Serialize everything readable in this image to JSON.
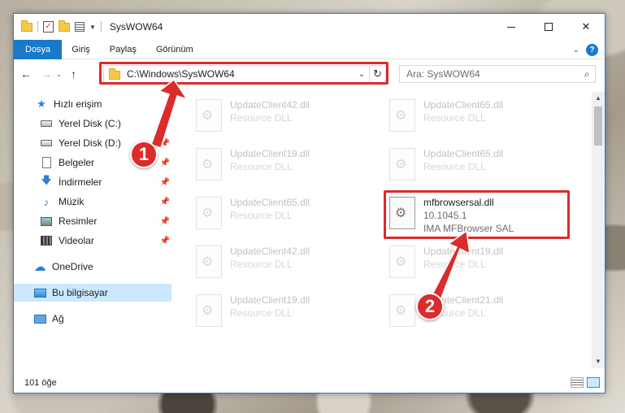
{
  "window": {
    "title": "SysWOW64",
    "controls": {
      "minimize": "",
      "maximize": "",
      "close": "✕"
    }
  },
  "ribbon": {
    "tabs": [
      {
        "label": "Dosya",
        "active": true
      },
      {
        "label": "Giriş"
      },
      {
        "label": "Paylaş"
      },
      {
        "label": "Görünüm"
      }
    ],
    "help": "?"
  },
  "nav": {
    "back": "←",
    "forward": "→",
    "recent": "⌄",
    "up": "↑",
    "address": "C:\\Windows\\SysWOW64",
    "refresh": "↻",
    "search_placeholder": "Ara: SysWOW64",
    "search_icon": "⌕"
  },
  "sidebar": {
    "items": [
      {
        "label": "Hızlı erişim",
        "icon": "star-icon",
        "glyph": "★",
        "pinned": false
      },
      {
        "label": "Yerel Disk (C:)",
        "icon": "drive-icon",
        "pinned": true
      },
      {
        "label": "Yerel Disk (D:)",
        "icon": "drive-icon",
        "pinned": true
      },
      {
        "label": "Belgeler",
        "icon": "document-icon",
        "pinned": true
      },
      {
        "label": "İndirmeler",
        "icon": "download-icon",
        "glyph": "🡇",
        "pinned": true
      },
      {
        "label": "Müzik",
        "icon": "music-icon",
        "glyph": "♪",
        "pinned": true
      },
      {
        "label": "Resimler",
        "icon": "pictures-icon",
        "pinned": true
      },
      {
        "label": "Videolar",
        "icon": "videos-icon",
        "pinned": true
      },
      {
        "label": "OneDrive",
        "icon": "cloud-icon",
        "glyph": "☁"
      },
      {
        "label": "Bu bilgisayar",
        "icon": "computer-icon",
        "selected": true
      },
      {
        "label": "Ağ",
        "icon": "network-icon"
      }
    ],
    "pin_glyph": "📌"
  },
  "files": [
    {
      "name": "UpdateClient42.dll",
      "desc": "Resource DLL"
    },
    {
      "name": "UpdateClient65.dll",
      "desc": "Resource DLL"
    },
    {
      "name": "UpdateClient19.dll",
      "desc": "Resource DLL"
    },
    {
      "name": "UpdateClient65.dll",
      "desc": "Resource DLL"
    },
    {
      "name": "UpdateClient65.dll",
      "desc": "Resource DLL"
    },
    {
      "name": "mfbrowsersal.dll",
      "desc": "10.1045.1",
      "desc2": "IMA MFBrowser SAL",
      "highlighted": true
    },
    {
      "name": "UpdateClient42.dll",
      "desc": "Resource DLL"
    },
    {
      "name": "UpdateClient19.dll",
      "desc": "Resource DLL"
    },
    {
      "name": "UpdateClient19.dll",
      "desc": "Resource DLL"
    },
    {
      "name": "UpdateClient21.dll",
      "desc": "Resource DLL"
    }
  ],
  "status": {
    "count": "101 öğe"
  },
  "callouts": {
    "step1": "1",
    "step2": "2"
  },
  "colors": {
    "accent": "#1979ca",
    "highlight": "#dc2b2b",
    "selection": "#cce8ff"
  }
}
